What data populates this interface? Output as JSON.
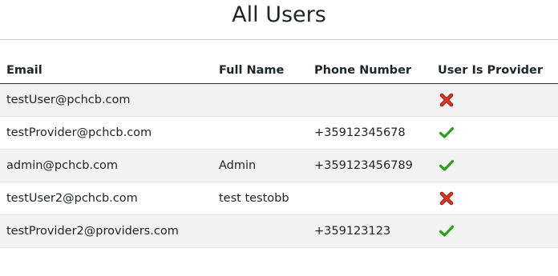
{
  "page": {
    "title": "All Users"
  },
  "table": {
    "headers": {
      "email": "Email",
      "full_name": "Full Name",
      "phone": "Phone Number",
      "is_provider": "User Is Provider"
    },
    "rows": [
      {
        "email": "testUser@pchcb.com",
        "full_name": "",
        "phone": "",
        "is_provider": false
      },
      {
        "email": "testProvider@pchcb.com",
        "full_name": "",
        "phone": "+35912345678",
        "is_provider": true
      },
      {
        "email": "admin@pchcb.com",
        "full_name": "Admin",
        "phone": "+359123456789",
        "is_provider": true
      },
      {
        "email": "testUser2@pchcb.com",
        "full_name": "test testobb",
        "phone": "",
        "is_provider": false
      },
      {
        "email": "testProvider2@providers.com",
        "full_name": "",
        "phone": "+359123123",
        "is_provider": true
      }
    ]
  },
  "icons": {
    "true": "check-icon",
    "false": "cross-icon"
  },
  "colors": {
    "check": "#2e9e1f",
    "cross": "#e0341d",
    "cross_outline": "#8a1c10",
    "row_stripe": "#f2f2f2"
  }
}
